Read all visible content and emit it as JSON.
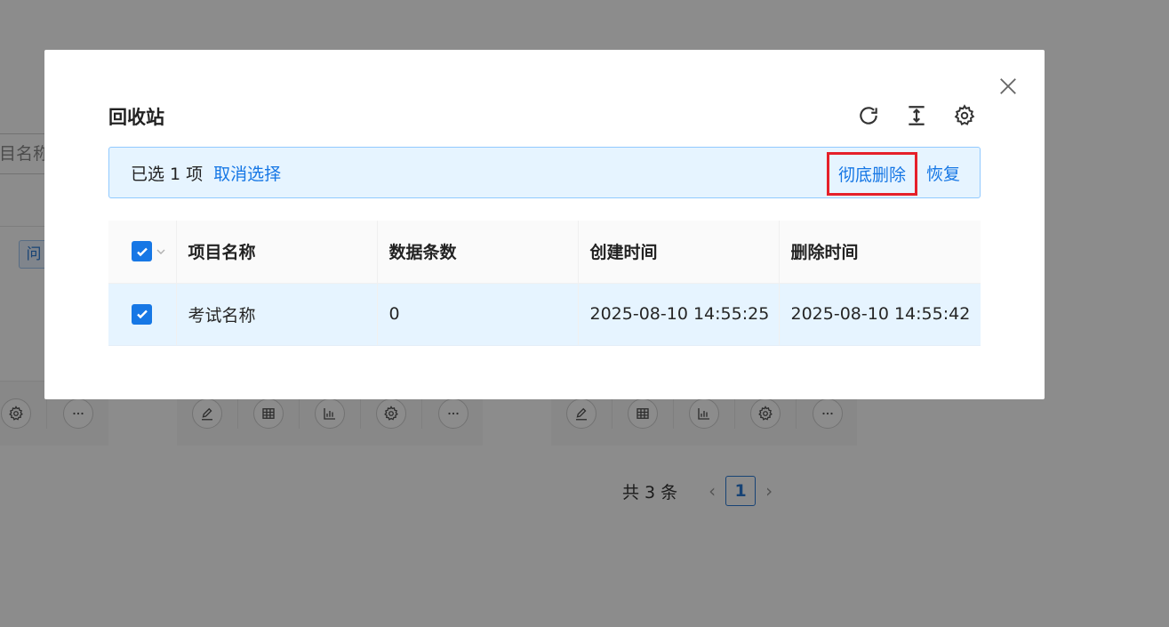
{
  "background": {
    "search_fragment": "目名称",
    "tag_fragment": "问",
    "pagination": {
      "total": "共 3 条",
      "current_page": "1",
      "prev_icon": "chevron-left-icon",
      "next_icon": "chevron-right-icon"
    },
    "card_actions": [
      "edit-icon",
      "table-icon",
      "chart-icon",
      "gear-icon",
      "more-icon"
    ]
  },
  "modal": {
    "title": "回收站",
    "toolbar": [
      "refresh-icon",
      "column-height-icon",
      "gear-icon"
    ],
    "alert": {
      "selected_text": "已选 1 项",
      "cancel_label": "取消选择",
      "delete_label": "彻底删除",
      "restore_label": "恢复"
    },
    "table": {
      "headers": [
        "项目名称",
        "数据条数",
        "创建时间",
        "删除时间"
      ],
      "rows": [
        {
          "selected": true,
          "name": "考试名称",
          "count": "0",
          "created": "2025-08-10 14:55:25",
          "deleted": "2025-08-10 14:55:42"
        }
      ]
    }
  },
  "colors": {
    "accent": "#1677e5",
    "highlight": "#e5202a",
    "selection_bg": "#e6f4ff"
  }
}
